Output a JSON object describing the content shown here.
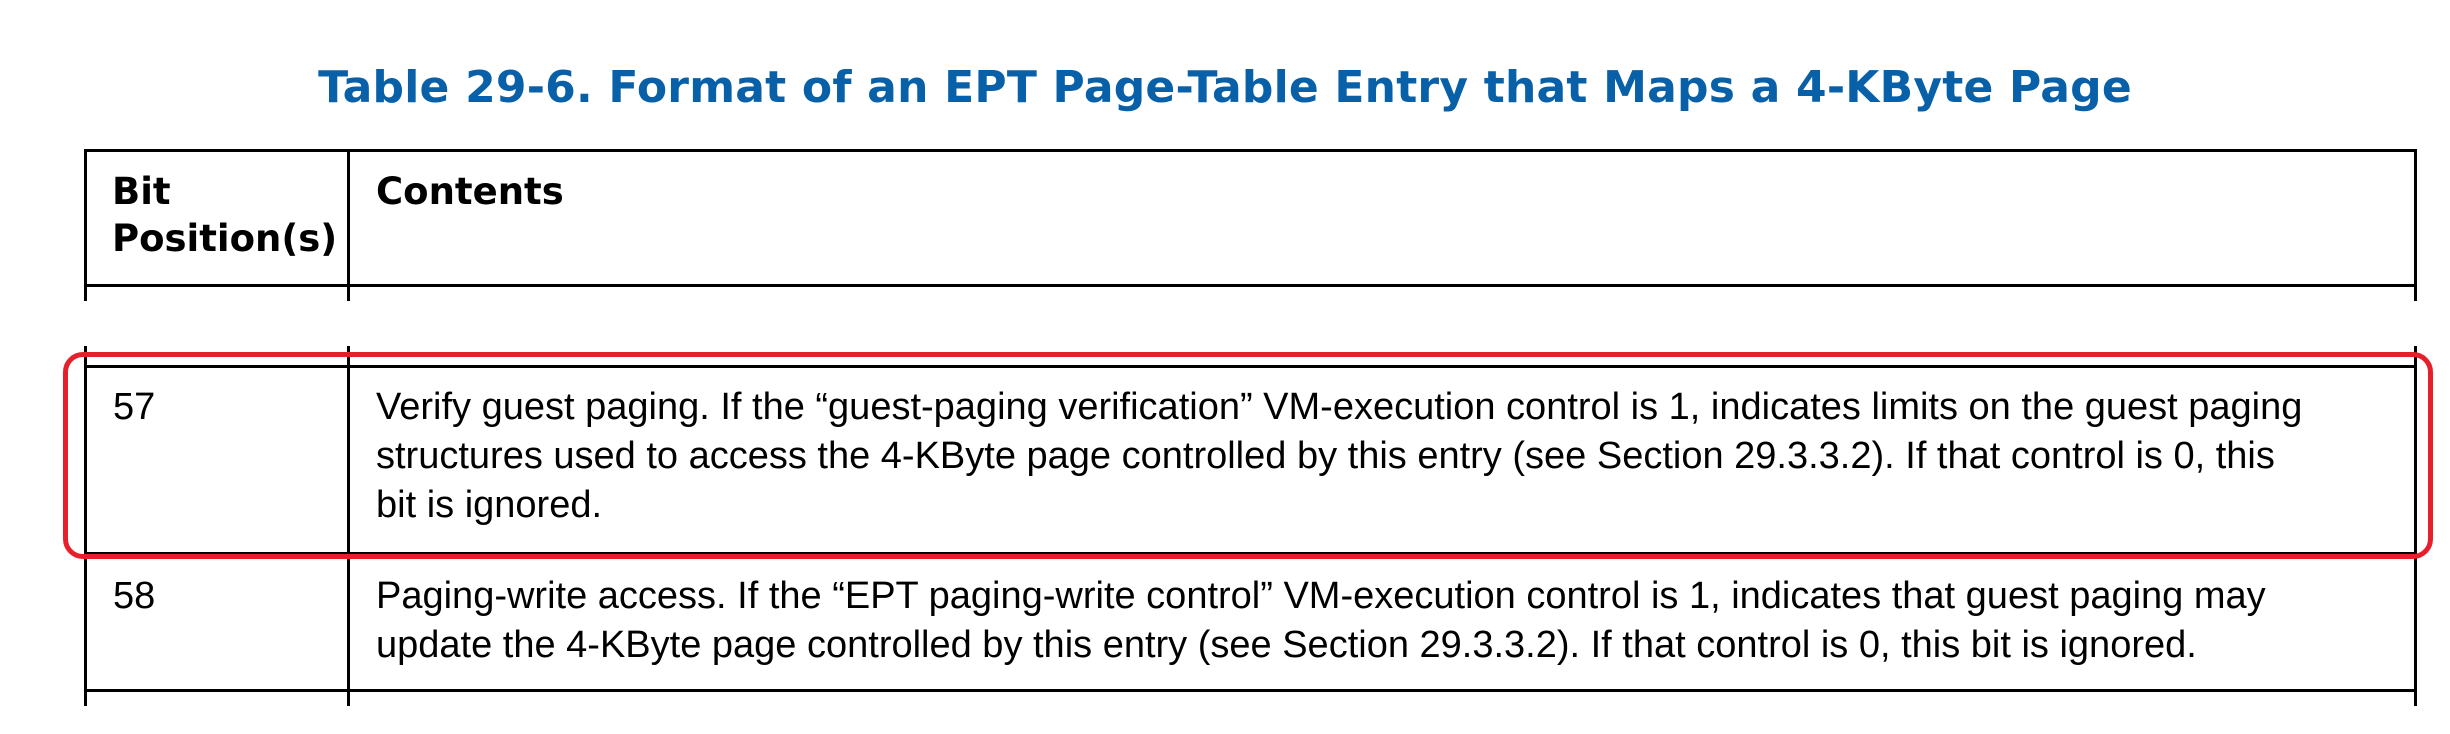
{
  "title": "Table 29-6.  Format of an EPT Page-Table Entry that Maps a 4-KByte Page",
  "table": {
    "headers": {
      "bit_positions_line1": "Bit",
      "bit_positions_line2": "Position(s)",
      "contents": "Contents"
    },
    "rows": [
      {
        "bit": "57",
        "contents_lines": [
          "Verify guest paging. If the “guest-paging verification” VM-execution control is 1, indicates limits on the guest paging",
          "structures used to access the 4-KByte page controlled by this entry (see Section 29.3.3.2). If that control is 0, this",
          "bit is ignored."
        ]
      },
      {
        "bit": "58",
        "contents_lines": [
          "Paging-write access. If the “EPT paging-write control” VM-execution control is 1, indicates that guest paging may",
          "update the 4-KByte page controlled by this entry (see Section 29.3.3.2). If that control is 0, this bit is ignored."
        ]
      }
    ]
  },
  "colors": {
    "title": "#0860a8",
    "highlight": "#e5202a"
  }
}
